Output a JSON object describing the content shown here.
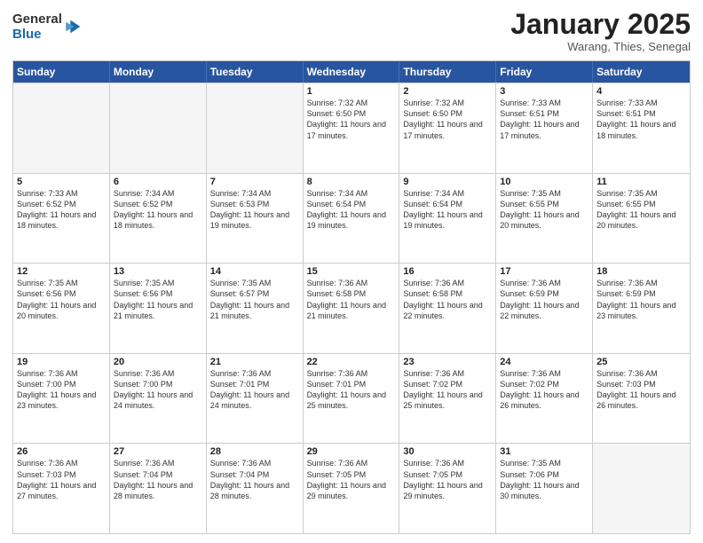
{
  "logo": {
    "general": "General",
    "blue": "Blue"
  },
  "title": "January 2025",
  "subtitle": "Warang, Thies, Senegal",
  "header_days": [
    "Sunday",
    "Monday",
    "Tuesday",
    "Wednesday",
    "Thursday",
    "Friday",
    "Saturday"
  ],
  "weeks": [
    [
      {
        "day": "",
        "empty": true
      },
      {
        "day": "",
        "empty": true
      },
      {
        "day": "",
        "empty": true
      },
      {
        "day": "1",
        "sunrise": "7:32 AM",
        "sunset": "6:50 PM",
        "daylight": "11 hours and 17 minutes."
      },
      {
        "day": "2",
        "sunrise": "7:32 AM",
        "sunset": "6:50 PM",
        "daylight": "11 hours and 17 minutes."
      },
      {
        "day": "3",
        "sunrise": "7:33 AM",
        "sunset": "6:51 PM",
        "daylight": "11 hours and 17 minutes."
      },
      {
        "day": "4",
        "sunrise": "7:33 AM",
        "sunset": "6:51 PM",
        "daylight": "11 hours and 18 minutes."
      }
    ],
    [
      {
        "day": "5",
        "sunrise": "7:33 AM",
        "sunset": "6:52 PM",
        "daylight": "11 hours and 18 minutes."
      },
      {
        "day": "6",
        "sunrise": "7:34 AM",
        "sunset": "6:52 PM",
        "daylight": "11 hours and 18 minutes."
      },
      {
        "day": "7",
        "sunrise": "7:34 AM",
        "sunset": "6:53 PM",
        "daylight": "11 hours and 19 minutes."
      },
      {
        "day": "8",
        "sunrise": "7:34 AM",
        "sunset": "6:54 PM",
        "daylight": "11 hours and 19 minutes."
      },
      {
        "day": "9",
        "sunrise": "7:34 AM",
        "sunset": "6:54 PM",
        "daylight": "11 hours and 19 minutes."
      },
      {
        "day": "10",
        "sunrise": "7:35 AM",
        "sunset": "6:55 PM",
        "daylight": "11 hours and 20 minutes."
      },
      {
        "day": "11",
        "sunrise": "7:35 AM",
        "sunset": "6:55 PM",
        "daylight": "11 hours and 20 minutes."
      }
    ],
    [
      {
        "day": "12",
        "sunrise": "7:35 AM",
        "sunset": "6:56 PM",
        "daylight": "11 hours and 20 minutes."
      },
      {
        "day": "13",
        "sunrise": "7:35 AM",
        "sunset": "6:56 PM",
        "daylight": "11 hours and 21 minutes."
      },
      {
        "day": "14",
        "sunrise": "7:35 AM",
        "sunset": "6:57 PM",
        "daylight": "11 hours and 21 minutes."
      },
      {
        "day": "15",
        "sunrise": "7:36 AM",
        "sunset": "6:58 PM",
        "daylight": "11 hours and 21 minutes."
      },
      {
        "day": "16",
        "sunrise": "7:36 AM",
        "sunset": "6:58 PM",
        "daylight": "11 hours and 22 minutes."
      },
      {
        "day": "17",
        "sunrise": "7:36 AM",
        "sunset": "6:59 PM",
        "daylight": "11 hours and 22 minutes."
      },
      {
        "day": "18",
        "sunrise": "7:36 AM",
        "sunset": "6:59 PM",
        "daylight": "11 hours and 23 minutes."
      }
    ],
    [
      {
        "day": "19",
        "sunrise": "7:36 AM",
        "sunset": "7:00 PM",
        "daylight": "11 hours and 23 minutes."
      },
      {
        "day": "20",
        "sunrise": "7:36 AM",
        "sunset": "7:00 PM",
        "daylight": "11 hours and 24 minutes."
      },
      {
        "day": "21",
        "sunrise": "7:36 AM",
        "sunset": "7:01 PM",
        "daylight": "11 hours and 24 minutes."
      },
      {
        "day": "22",
        "sunrise": "7:36 AM",
        "sunset": "7:01 PM",
        "daylight": "11 hours and 25 minutes."
      },
      {
        "day": "23",
        "sunrise": "7:36 AM",
        "sunset": "7:02 PM",
        "daylight": "11 hours and 25 minutes."
      },
      {
        "day": "24",
        "sunrise": "7:36 AM",
        "sunset": "7:02 PM",
        "daylight": "11 hours and 26 minutes."
      },
      {
        "day": "25",
        "sunrise": "7:36 AM",
        "sunset": "7:03 PM",
        "daylight": "11 hours and 26 minutes."
      }
    ],
    [
      {
        "day": "26",
        "sunrise": "7:36 AM",
        "sunset": "7:03 PM",
        "daylight": "11 hours and 27 minutes."
      },
      {
        "day": "27",
        "sunrise": "7:36 AM",
        "sunset": "7:04 PM",
        "daylight": "11 hours and 28 minutes."
      },
      {
        "day": "28",
        "sunrise": "7:36 AM",
        "sunset": "7:04 PM",
        "daylight": "11 hours and 28 minutes."
      },
      {
        "day": "29",
        "sunrise": "7:36 AM",
        "sunset": "7:05 PM",
        "daylight": "11 hours and 29 minutes."
      },
      {
        "day": "30",
        "sunrise": "7:36 AM",
        "sunset": "7:05 PM",
        "daylight": "11 hours and 29 minutes."
      },
      {
        "day": "31",
        "sunrise": "7:35 AM",
        "sunset": "7:06 PM",
        "daylight": "11 hours and 30 minutes."
      },
      {
        "day": "",
        "empty": true
      }
    ]
  ]
}
